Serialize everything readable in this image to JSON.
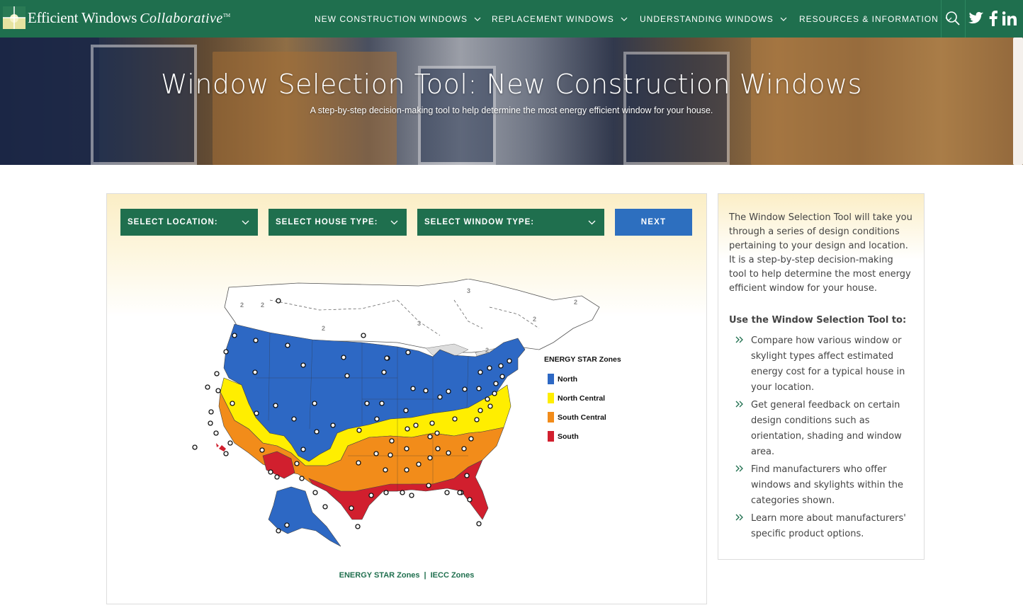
{
  "nav": {
    "logo_text": "Efficient Windows",
    "logo_script": "Collaborative",
    "logo_tm": "TM",
    "menu": [
      {
        "label": "NEW CONSTRUCTION WINDOWS"
      },
      {
        "label": "REPLACEMENT WINDOWS"
      },
      {
        "label": "UNDERSTANDING WINDOWS"
      },
      {
        "label": "RESOURCES & INFORMATION"
      }
    ],
    "icons": [
      "search-icon",
      "twitter-icon",
      "facebook-icon",
      "linkedin-icon"
    ]
  },
  "hero": {
    "title": "Window Selection Tool: New Construction Windows",
    "subtitle": "A step-by-step decision-making tool to help determine the most energy efficient window for your house."
  },
  "tool": {
    "select_location": "SELECT LOCATION:",
    "select_house_type": "SELECT HOUSE TYPE:",
    "select_window_type": "SELECT WINDOW TYPE:",
    "next_label": "NEXT"
  },
  "map": {
    "legend_title": "ENERGY STAR Zones",
    "zones": [
      {
        "label": "North",
        "color": "#2d68c4"
      },
      {
        "label": "North Central",
        "color": "#ffee00"
      },
      {
        "label": "South Central",
        "color": "#f28c1a"
      },
      {
        "label": "South",
        "color": "#d11f2e"
      }
    ],
    "canada_zone_labels": [
      "2",
      "2",
      "3",
      "3",
      "2",
      "2",
      "2",
      "2"
    ],
    "links": {
      "energy_star": "ENERGY STAR Zones",
      "separator": "|",
      "iecc": "IECC Zones"
    }
  },
  "side": {
    "intro": "The Window Selection Tool will take you through a series of design conditions pertaining to your design and location. It is a step-by-step decision-making tool to help determine the most energy efficient window for your house.",
    "heading": "Use the Window Selection Tool to:",
    "bullets": [
      "Compare how various window or skylight types affect estimated energy cost for a typical house in your location.",
      "Get general feedback on certain design conditions such as orientation, shading and window area.",
      "Find manufacturers who offer windows and skylights within the categories shown.",
      "Learn more about manufacturers' specific product options."
    ]
  },
  "colors": {
    "brand_green": "#1f6f4e",
    "next_blue": "#2d6fbf"
  }
}
